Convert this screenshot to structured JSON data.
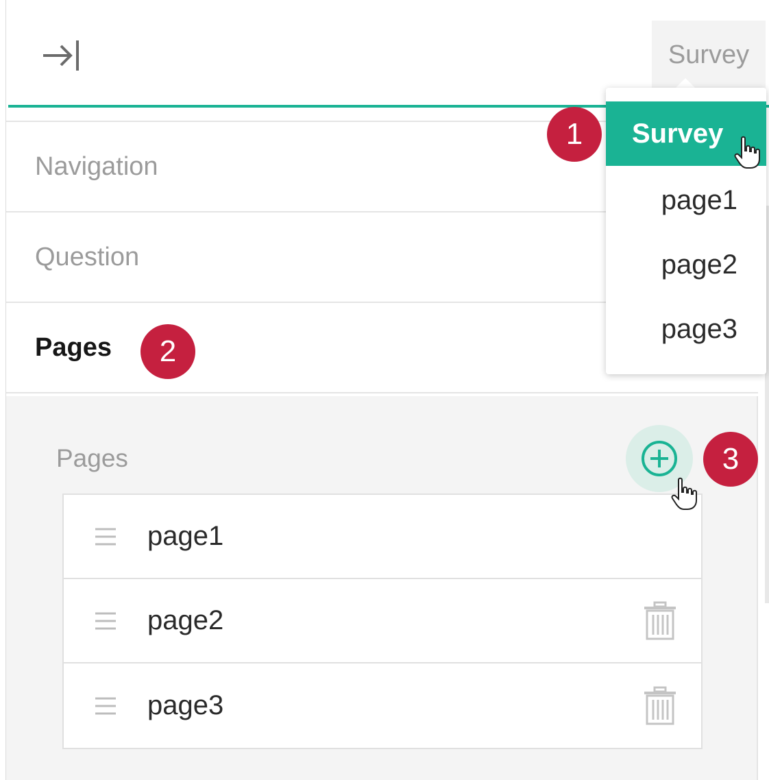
{
  "header": {
    "collapse_icon": "arrow-to-right-bar-icon",
    "selector_label": "Survey"
  },
  "dropdown": {
    "options": [
      {
        "label": "Survey",
        "selected": true
      },
      {
        "label": "page1",
        "selected": false
      },
      {
        "label": "page2",
        "selected": false
      },
      {
        "label": "page3",
        "selected": false
      }
    ]
  },
  "tabs": [
    {
      "label": "Navigation",
      "active": false
    },
    {
      "label": "Question",
      "active": false
    },
    {
      "label": "Pages",
      "active": true
    }
  ],
  "pages_panel": {
    "title": "Pages",
    "add_icon": "plus-circle-icon",
    "items": [
      {
        "label": "page1",
        "deletable": false
      },
      {
        "label": "page2",
        "deletable": true
      },
      {
        "label": "page3",
        "deletable": true
      }
    ]
  },
  "badges": [
    "1",
    "2",
    "3"
  ],
  "colors": {
    "accent": "#1ab394",
    "badge": "#c5203f",
    "muted_text": "#9b9b9b",
    "panel_bg": "#f4f4f4"
  }
}
